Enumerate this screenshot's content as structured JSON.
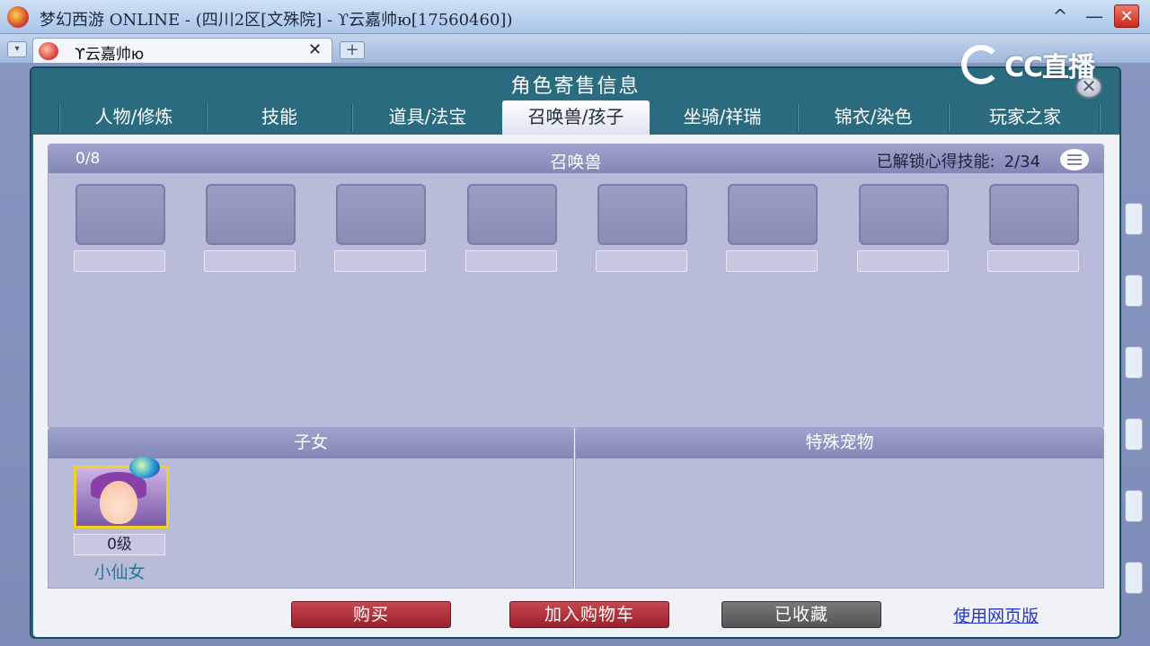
{
  "window": {
    "title": "梦幻西游 ONLINE - (四川2区[文殊院] - ϒ云嘉帅ю[17560460])",
    "controls": {
      "minimize": "^",
      "restore": "—",
      "close": "✕"
    }
  },
  "tabs": {
    "current_label": "ϒ云嘉帅ю",
    "close": "✕",
    "add": "+",
    "arrow": "▾"
  },
  "overlay": {
    "logo_text": "CC直播"
  },
  "dialog": {
    "title": "角色寄售信息",
    "close": "✕",
    "nav": [
      {
        "label": "人物/修炼"
      },
      {
        "label": "技能"
      },
      {
        "label": "道具/法宝"
      },
      {
        "label": "召唤兽/孩子"
      },
      {
        "label": "坐骑/祥瑞"
      },
      {
        "label": "锦衣/染色"
      },
      {
        "label": "玩家之家"
      }
    ],
    "active_tab": "召唤兽/孩子",
    "pets": {
      "count": "0/8",
      "title": "召唤兽",
      "skill_label": "已解锁心得技能:",
      "skill_value": "2/34"
    },
    "children": {
      "title": "子女",
      "items": [
        {
          "level": "0级",
          "name": "小仙女"
        }
      ]
    },
    "special_pets": {
      "title": "特殊宠物"
    },
    "buttons": {
      "buy": "购买",
      "add_cart": "加入购物车",
      "favorited": "已收藏",
      "web_version": "使用网页版"
    }
  }
}
